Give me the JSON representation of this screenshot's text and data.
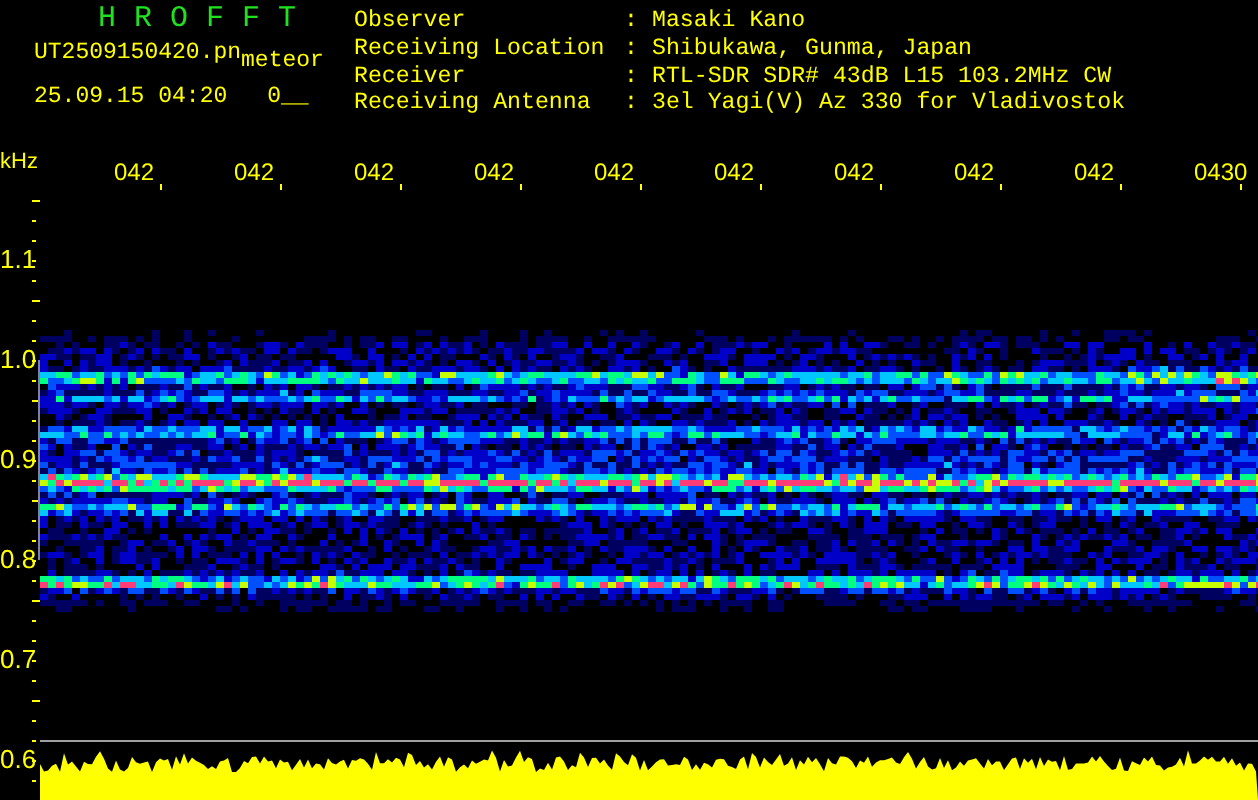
{
  "header": {
    "title": "H R O F F T",
    "file_name": "UT2509150420.pn",
    "file_suffix": "meteor",
    "timestamp": "25.09.15 04:20",
    "status": "0__",
    "fields": [
      {
        "label": "Observer",
        "separator": ":",
        "value": "Masaki Kano"
      },
      {
        "label": "Receiving Location",
        "separator": ":",
        "value": "Shibukawa, Gunma, Japan"
      },
      {
        "label": "Receiver",
        "separator": ":",
        "value": "RTL-SDR SDR# 43dB L15 103.2MHz CW"
      },
      {
        "label": "Receiving Antenna",
        "separator": ":",
        "value": "3el Yagi(V) Az 330 for Vladivostok"
      }
    ]
  },
  "plot": {
    "freq_unit": "kHz",
    "time_labels": [
      "042",
      "042",
      "042",
      "042",
      "042",
      "042",
      "042",
      "042",
      "042",
      "0430"
    ],
    "freq_labels": [
      "1.1",
      "1.0",
      "0.9",
      "0.8",
      "0.7",
      "0.6"
    ]
  }
}
